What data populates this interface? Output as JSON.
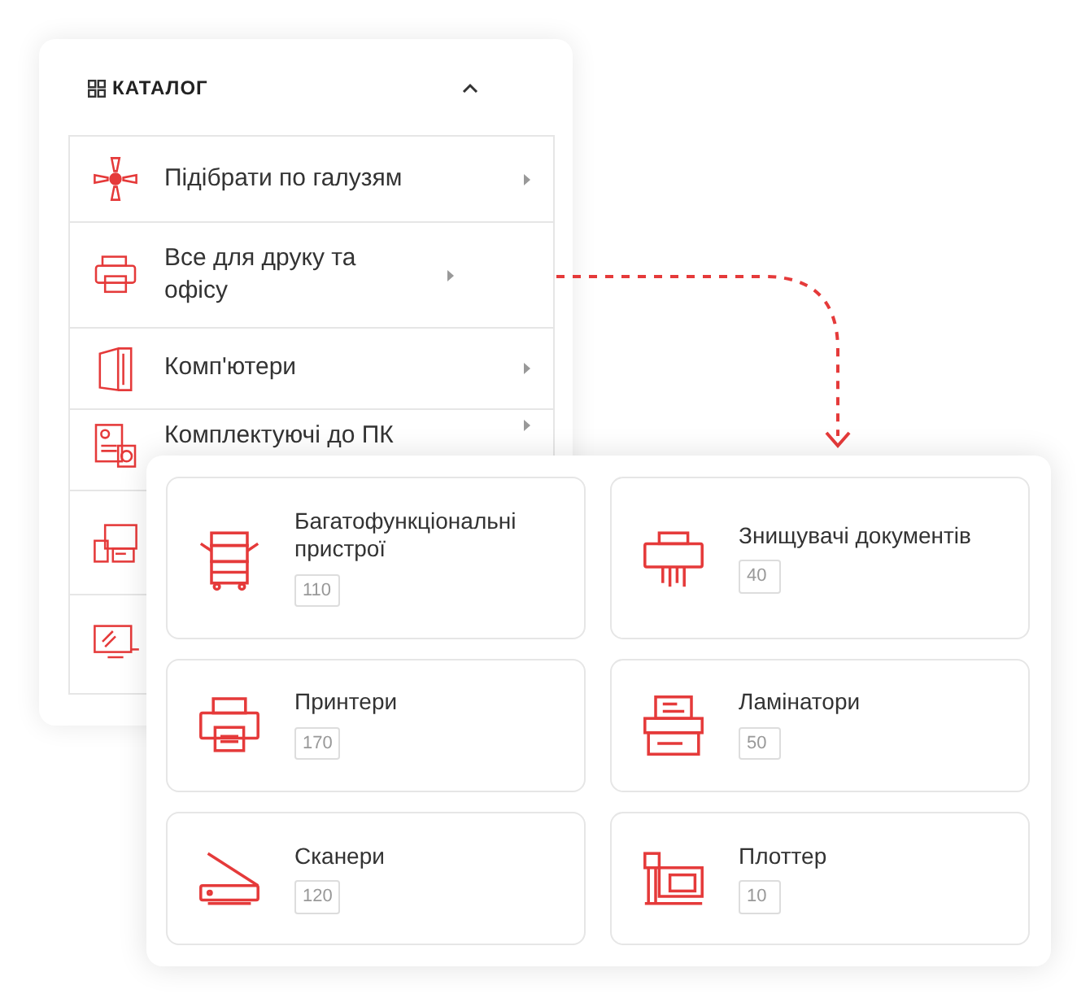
{
  "catalog": {
    "title": "КАТАЛОГ",
    "expanded": true,
    "items": [
      {
        "kind": "entry",
        "label": "Підібрати по галузям"
      },
      {
        "kind": "entry",
        "label": "Все для друку та офісу"
      },
      {
        "kind": "entry",
        "label": "Комп'ютери"
      },
      {
        "kind": "entry",
        "label": "Комплектуючі до ПК"
      },
      {
        "kind": "covered"
      },
      {
        "kind": "covered"
      }
    ]
  },
  "subcategories": [
    {
      "label": "Багатофункціональні пристрої",
      "count": "110"
    },
    {
      "label": "Знищувачі документів",
      "count": "40"
    },
    {
      "label": "Принтери",
      "count": "170"
    },
    {
      "label": "Ламінатори",
      "count": "50"
    },
    {
      "label": "Сканери",
      "count": "120"
    },
    {
      "label": "Плоттер",
      "count": "10"
    }
  ]
}
